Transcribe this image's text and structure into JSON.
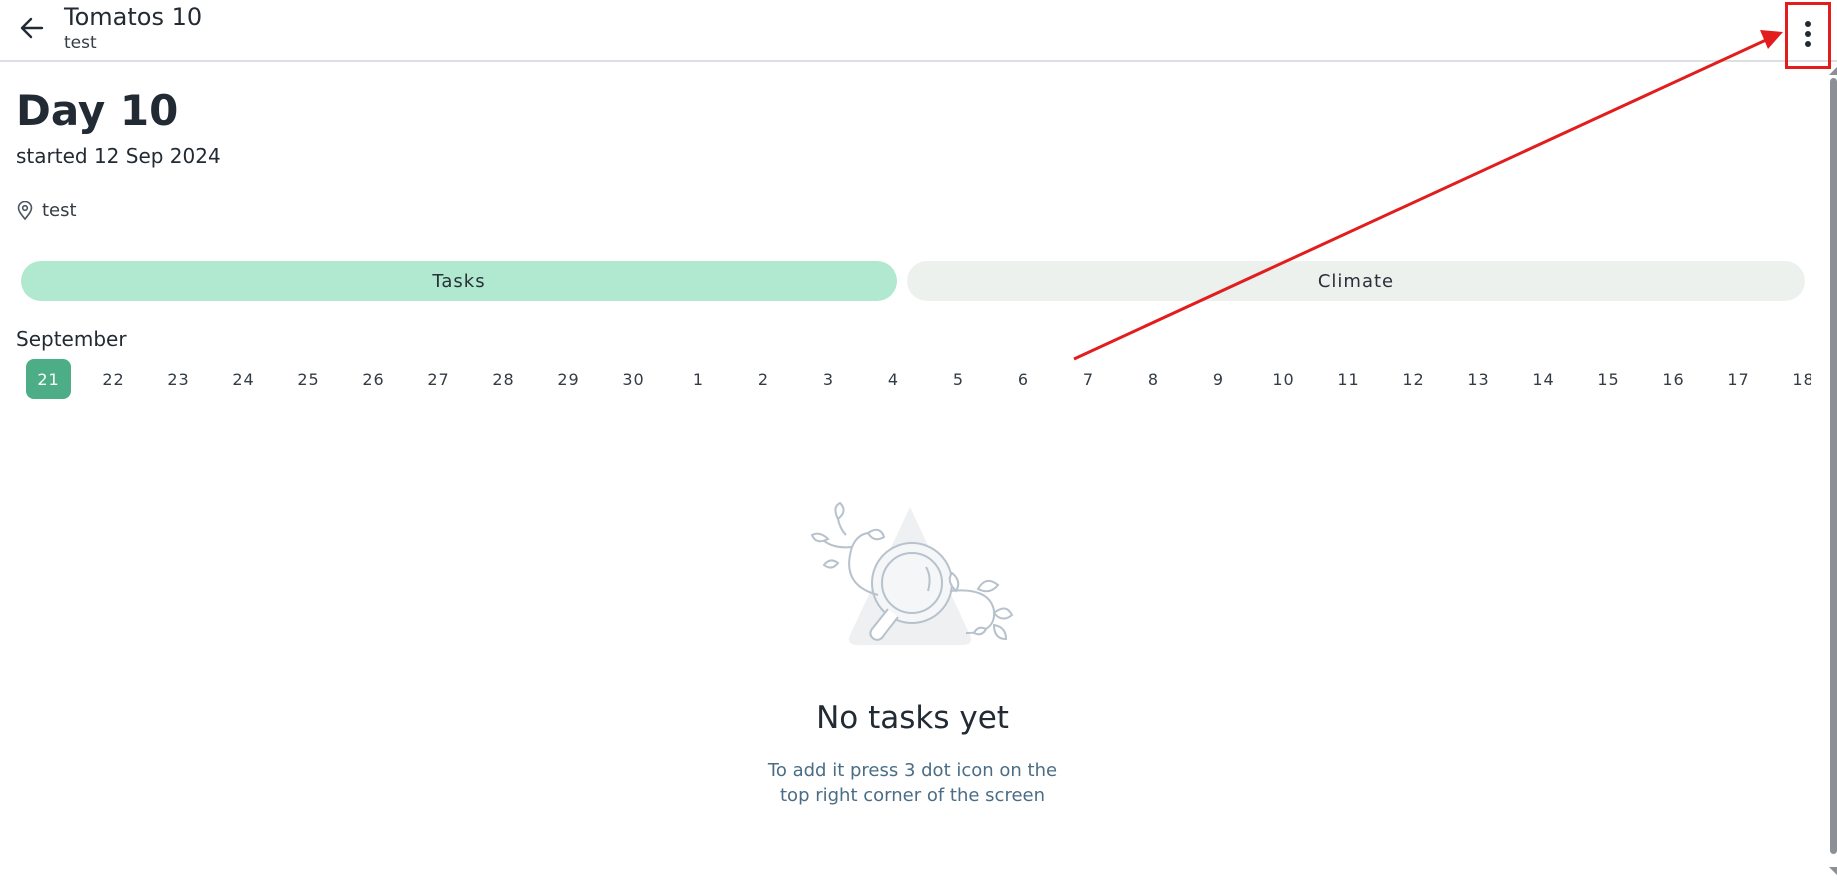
{
  "header": {
    "title": "Tomatos 10",
    "subtitle": "test",
    "back_icon": "arrow-left-icon",
    "menu_icon": "three-dot-vertical-icon"
  },
  "summary": {
    "day_title": "Day 10",
    "started": "started 12 Sep 2024",
    "location_icon": "location-pin-icon",
    "location": "test"
  },
  "tabs": [
    {
      "label": "Tasks",
      "active": true
    },
    {
      "label": "Climate",
      "active": false
    }
  ],
  "calendar": {
    "month": "September",
    "days": [
      "21",
      "22",
      "23",
      "24",
      "25",
      "26",
      "27",
      "28",
      "29",
      "30",
      "1",
      "2",
      "3",
      "4",
      "5",
      "6",
      "7",
      "8",
      "9",
      "10",
      "11",
      "12",
      "13",
      "14",
      "15",
      "16",
      "17",
      "18"
    ],
    "selected_index": 0
  },
  "empty_state": {
    "illustration_icon": "magnifier-plants-illustration",
    "title": "No tasks yet",
    "hint_line1": "To add it press 3 dot icon on the",
    "hint_line2": "top right corner of the screen"
  },
  "colors": {
    "accent": "#4cad87",
    "tab_active": "#b0e9cf",
    "tab_inactive": "#edf1ee",
    "annotation": "#e11d1d",
    "hint_text": "#4a6d85"
  }
}
